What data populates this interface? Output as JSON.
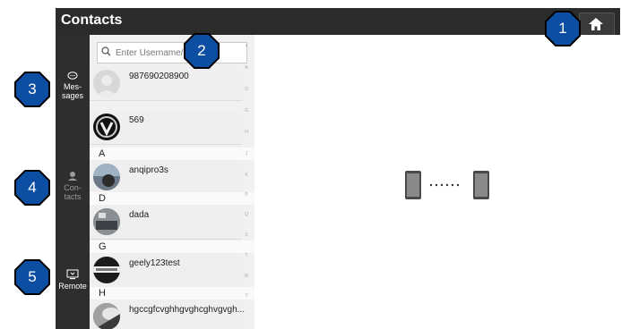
{
  "window": {
    "title": "Contacts"
  },
  "header": {
    "home_icon": "home-icon"
  },
  "sidebar": {
    "items": [
      {
        "label_line1": "Mes-",
        "label_line2": "sages",
        "icon": "chat-bubble-icon"
      },
      {
        "label_line1": "Con-",
        "label_line2": "tacts",
        "icon": "contacts-icon"
      },
      {
        "label_line1": "Remote",
        "label_line2": "",
        "icon": "remote-screen-icon"
      }
    ]
  },
  "search": {
    "placeholder": "Enter Username/M",
    "icon": "search-icon"
  },
  "contacts": {
    "rows": [
      {
        "name": "987690208900"
      },
      {
        "name": "569"
      },
      {
        "name": "anqipro3s"
      },
      {
        "name": "dada"
      },
      {
        "name": "geely123test"
      },
      {
        "name": "hgccgfcvghhgvghcghvgvgh..."
      }
    ],
    "sections": [
      "A",
      "D",
      "G",
      "H"
    ]
  },
  "alphabet_index": [
    "#",
    "A",
    "D",
    "G",
    "H",
    "J",
    "K",
    "P",
    "Q",
    "S",
    "T",
    "W",
    "Y"
  ],
  "annotations": [
    "1",
    "2",
    "3",
    "4",
    "5"
  ],
  "colors": {
    "titlebar": "#2b2b2b",
    "sidebar": "#2e2e2e",
    "badge": "#0b4ea2",
    "badge_outline": "#000000"
  }
}
